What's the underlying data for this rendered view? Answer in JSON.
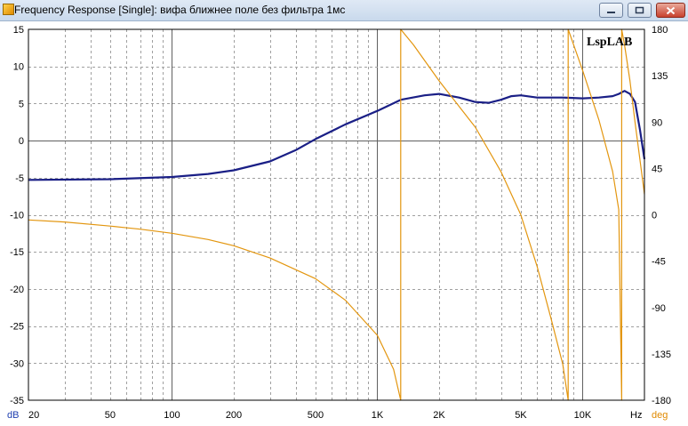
{
  "window": {
    "title": "Frequency Response [Single]: вифа ближнее поле без фильтра 1мс",
    "buttons": {
      "minimize": "—",
      "maximize": "▢",
      "close": "✕"
    }
  },
  "chart_data": {
    "type": "line",
    "watermark": "LspLAB",
    "x_scale": "log",
    "xlim": [
      20,
      20000
    ],
    "x_ticks": [
      20,
      50,
      100,
      200,
      500,
      1000,
      2000,
      5000,
      10000
    ],
    "x_tick_labels": [
      "20",
      "50",
      "100",
      "200",
      "500",
      "1K",
      "2K",
      "5K",
      "10K"
    ],
    "x_unit": "Hz",
    "y_left": {
      "unit": "dB",
      "lim": [
        -35,
        15
      ],
      "ticks": [
        "15",
        "10",
        "5",
        "0",
        "-5",
        "-10",
        "-15",
        "-20",
        "-25",
        "-30",
        "-35"
      ]
    },
    "y_right": {
      "unit": "deg",
      "lim": [
        -180,
        180
      ],
      "ticks": [
        "180",
        "135",
        "90",
        "45",
        "0",
        "-45",
        "-90",
        "-135",
        "-180"
      ]
    },
    "grid": true,
    "colors": {
      "magnitude": "#1a1f86",
      "phase": "#e3960f",
      "grid": "#a0a0a0",
      "axis": "#000000"
    },
    "series": [
      {
        "axis": "left",
        "x": [
          20,
          50,
          100,
          150,
          200,
          300,
          400,
          500,
          700,
          1000,
          1300,
          1700,
          2000,
          2500,
          3000,
          3500,
          4000,
          4500,
          5000,
          6000,
          7000,
          8000,
          10000,
          12000,
          14000,
          15000,
          16000,
          17000,
          18000,
          19000,
          20000
        ],
        "y": [
          -5.3,
          -5.2,
          -4.9,
          -4.5,
          -4.0,
          -2.8,
          -1.3,
          0.2,
          2.2,
          4.0,
          5.5,
          6.1,
          6.3,
          5.8,
          5.2,
          5.1,
          5.5,
          6.0,
          6.1,
          5.8,
          5.8,
          5.8,
          5.7,
          5.8,
          6.0,
          6.3,
          6.7,
          6.3,
          5.2,
          1.5,
          -2.5
        ]
      },
      {
        "axis": "right",
        "x": [
          20,
          30,
          50,
          70,
          100,
          150,
          200,
          300,
          500,
          700,
          1000,
          1200,
          1300,
          1300,
          1500,
          2000,
          3000,
          4000,
          5000,
          6000,
          7000,
          8000,
          8500,
          8500,
          9000,
          10000,
          12000,
          14000,
          15000,
          15500,
          15500,
          16000,
          17000,
          18000,
          20000
        ],
        "y": [
          -5,
          -7,
          -11,
          -14,
          -18,
          -24,
          -30,
          -42,
          -62,
          -83,
          -117,
          -150,
          -180,
          180,
          165,
          130,
          85,
          42,
          0,
          -50,
          -100,
          -145,
          -180,
          180,
          166,
          140,
          92,
          42,
          5,
          -180,
          180,
          165,
          130,
          90,
          20
        ]
      }
    ]
  }
}
